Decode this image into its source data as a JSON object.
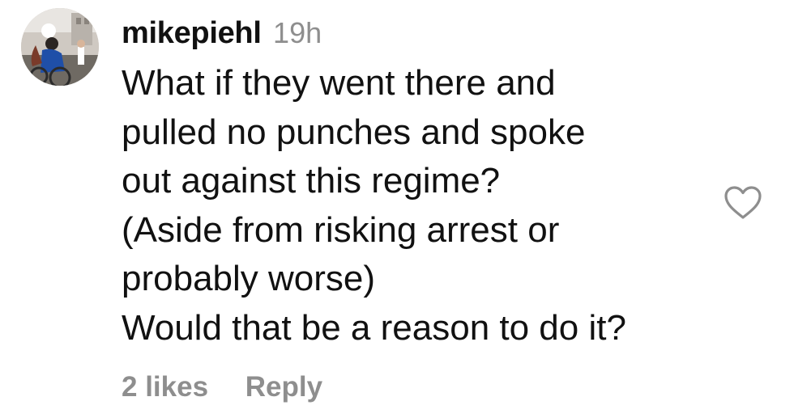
{
  "comment": {
    "username": "mikepiehl",
    "timestamp": "19h",
    "body_lines": [
      "What if they went there and",
      "pulled no punches and spoke",
      "out against this regime?",
      "(Aside from risking arrest or",
      "probably worse)",
      "Would that be a reason to do it?"
    ],
    "likes_label": "2 likes",
    "reply_label": "Reply"
  },
  "icons": {
    "like": "heart-outline-icon",
    "avatar": "profile-photo"
  },
  "colors": {
    "text": "#111111",
    "muted": "#8e8e8e",
    "background": "#ffffff"
  }
}
